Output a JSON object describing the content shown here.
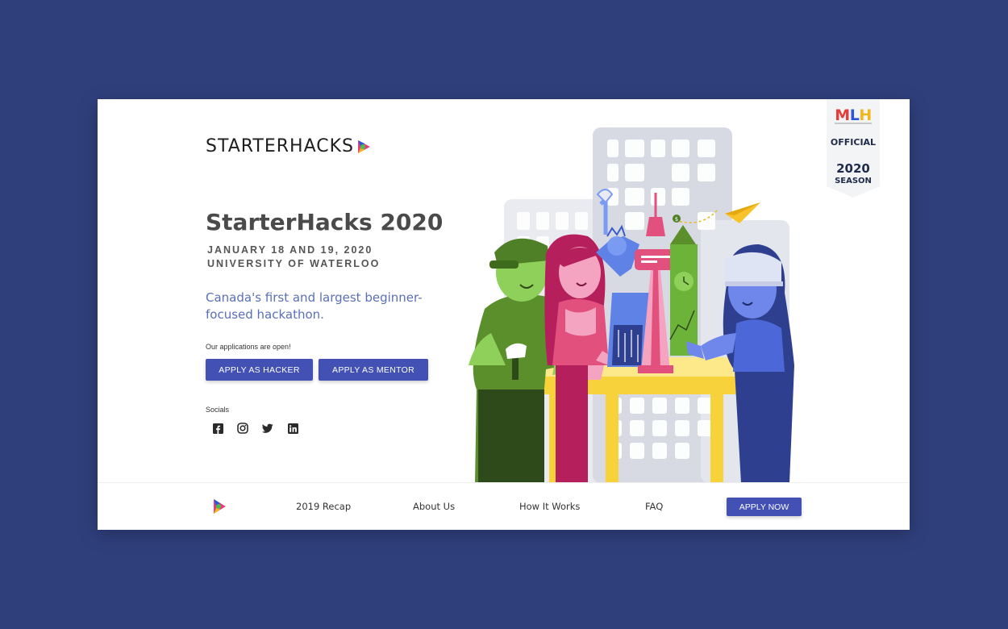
{
  "brand": {
    "logo_text": "STARTERHACKS",
    "title": "StarterHacks 2020",
    "date": "JANUARY 18 AND 19, 2020",
    "venue": "UNIVERSITY OF WATERLOO",
    "tagline": "Canada's first and largest beginner-focused hackathon."
  },
  "cta": {
    "status": "Our applications are open!",
    "hacker_label": "APPLY AS HACKER",
    "mentor_label": "APPLY AS MENTOR"
  },
  "socials": {
    "label": "Socials",
    "items": [
      "facebook-icon",
      "instagram-icon",
      "twitter-icon",
      "linkedin-icon"
    ]
  },
  "badge": {
    "line1": "OFFICIAL",
    "line2": "2020",
    "line3": "SEASON"
  },
  "footer": {
    "nav": [
      "2019 Recap",
      "About Us",
      "How It Works",
      "FAQ"
    ],
    "apply_label": "APPLY NOW"
  },
  "colors": {
    "page_bg": "#2f3f7c",
    "primary": "#4351b4",
    "tagline": "#5a6fb9"
  }
}
